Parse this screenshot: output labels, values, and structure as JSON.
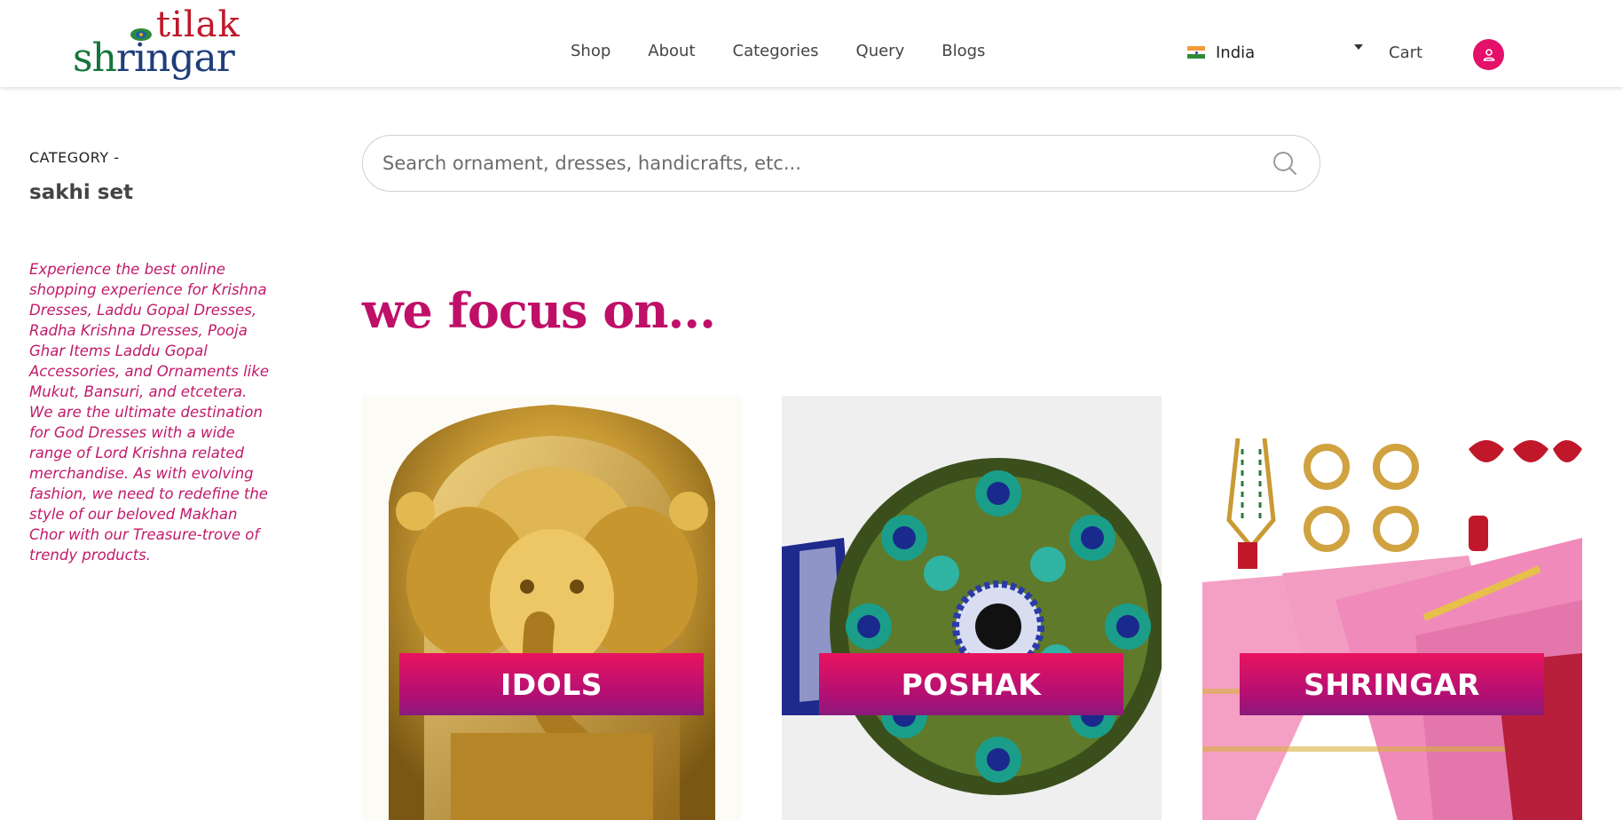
{
  "header": {
    "logo": {
      "top": "tilak",
      "bottom_left": "sh",
      "bottom_dark": "ringar"
    },
    "nav": [
      "Shop",
      "About",
      "Categories",
      "Query",
      "Blogs"
    ],
    "country": {
      "label": "India",
      "icon": "india-flag-icon"
    },
    "cart_label": "Cart",
    "account_icon": "user-icon"
  },
  "sidebar": {
    "category_prefix": "CATEGORY -",
    "category_name": "sakhi set",
    "blurb": "Experience the best online shopping experience for Krishna Dresses, Laddu Gopal Dresses, Radha Krishna Dresses, Pooja Ghar Items Laddu Gopal Accessories, and Ornaments like Mukut, Bansuri, and etcetera. We are the ultimate destination for God Dresses with a wide range of Lord Krishna related merchandise. As with evolving fashion, we need to redefine the style of our beloved Makhan Chor with our Treasure-trove of trendy products."
  },
  "search": {
    "placeholder": "Search ornament, dresses, handicrafts, etc..."
  },
  "focus": {
    "heading": "we focus on...",
    "cards": [
      {
        "label": "IDOLS"
      },
      {
        "label": "POSHAK"
      },
      {
        "label": "SHRINGAR"
      }
    ]
  },
  "colors": {
    "brand_pink": "#bf1068",
    "label_gradient_top": "#e8135f",
    "label_gradient_bottom": "#8a1a7c"
  }
}
